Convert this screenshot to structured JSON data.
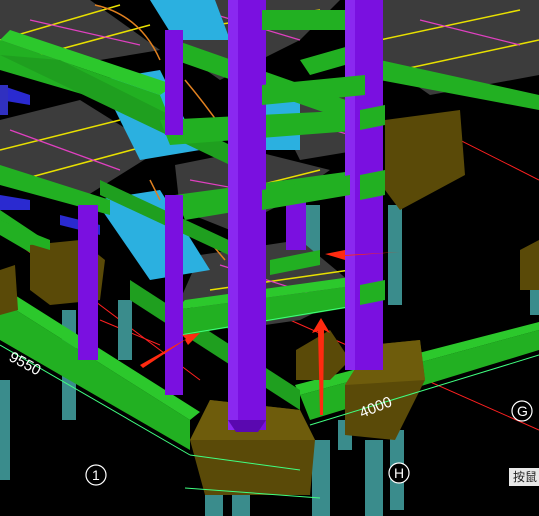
{
  "viewport": {
    "background": "#000000",
    "colors": {
      "slab": "#3c3c3c",
      "beam": "#22b022",
      "column": "#7a10e0",
      "footing": "#5a4a08",
      "pile": "#3a8c8c",
      "stair": "#2bb0e0",
      "rebar_yellow": "#e8e000",
      "rebar_magenta": "#e040c0",
      "edge_cyan": "#40ff80",
      "axis_red": "#ff2020",
      "arrow": "#ff2a10",
      "railing": "#e08020"
    }
  },
  "dimensions": {
    "d1": "9550",
    "d2": "4000"
  },
  "axes": {
    "a1": "1",
    "ah": "H",
    "ag": "G"
  },
  "hint": {
    "text": "按鼠"
  }
}
